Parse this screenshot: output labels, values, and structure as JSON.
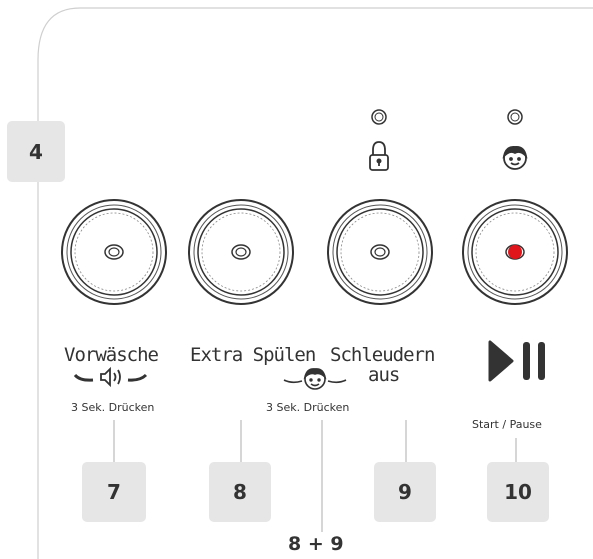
{
  "panel_marker": "4",
  "buttons": [
    {
      "id": "vorwaesche",
      "label": "Vorwäsche",
      "note": "3 Sek. Drücken",
      "callout": "7"
    },
    {
      "id": "extra-spuelen",
      "label": "Extra Spülen",
      "note": "3 Sek. Drücken",
      "callout": "8"
    },
    {
      "id": "schleudern-aus",
      "label_line1": "Schleudern",
      "label_line2": "aus",
      "callout": "9"
    },
    {
      "id": "start-pause",
      "label": "Start / Pause",
      "callout": "10",
      "led_color": "#e0151b"
    }
  ],
  "combo_callout": "8 + 9",
  "icons": [
    "lock-icon",
    "child-face-icon",
    "sound-icon",
    "play-pause-icon"
  ]
}
